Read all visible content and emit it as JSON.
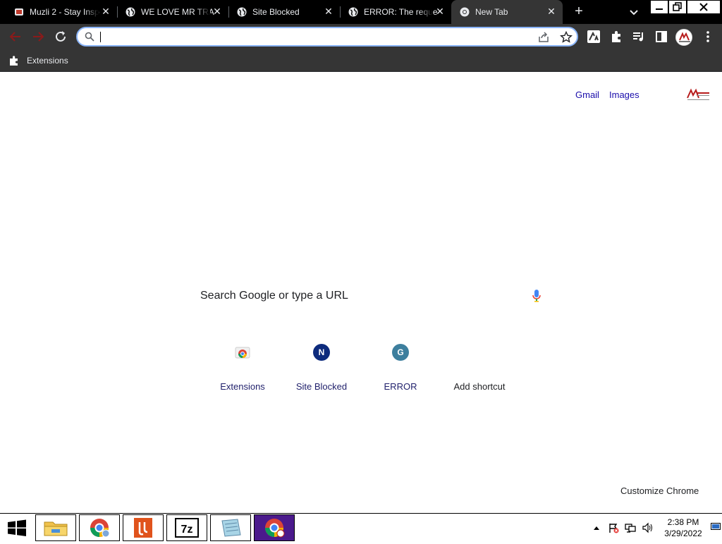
{
  "tabs": [
    {
      "title": "Muzli 2 - Stay Insp",
      "favicon": "muzli-icon",
      "active": false
    },
    {
      "title": "WE LOVE MR TRA",
      "favicon": "globe-icon",
      "active": false
    },
    {
      "title": "Site Blocked",
      "favicon": "globe-icon",
      "active": false
    },
    {
      "title": "ERROR: The reque",
      "favicon": "globe-icon",
      "active": false
    },
    {
      "title": "New Tab",
      "favicon": "chrome-icon",
      "active": true
    }
  ],
  "tab_close_glyph": "✕",
  "new_tab_glyph": "+",
  "omnibox": {
    "value": ""
  },
  "bookmarks": {
    "extensions_label": "Extensions"
  },
  "page": {
    "gmail": "Gmail",
    "images": "Images",
    "search_placeholder": "Search Google or type a URL",
    "shortcuts": [
      {
        "label": "Extensions",
        "tile": "",
        "color": ""
      },
      {
        "label": "Site Blocked",
        "tile": "N",
        "color": "#0d2b7d"
      },
      {
        "label": "ERROR",
        "tile": "G",
        "color": "#3d7f9e"
      },
      {
        "label": "Add shortcut",
        "tile": "",
        "color": ""
      }
    ],
    "customize": "Customize Chrome"
  },
  "taskbar": {
    "time": "2:38 PM",
    "date": "3/29/2022",
    "apps": [
      "file-explorer-icon",
      "chrome-user-icon",
      "pdf-app-icon",
      "7zip-icon",
      "notepad-icon",
      "chrome-icon"
    ]
  },
  "colors": {
    "accent": "#8ab4f8",
    "toolbar": "#353535",
    "tabstrip": "#000000",
    "link": "#1a0dab",
    "active_taskbar": "#4b1a8c"
  }
}
